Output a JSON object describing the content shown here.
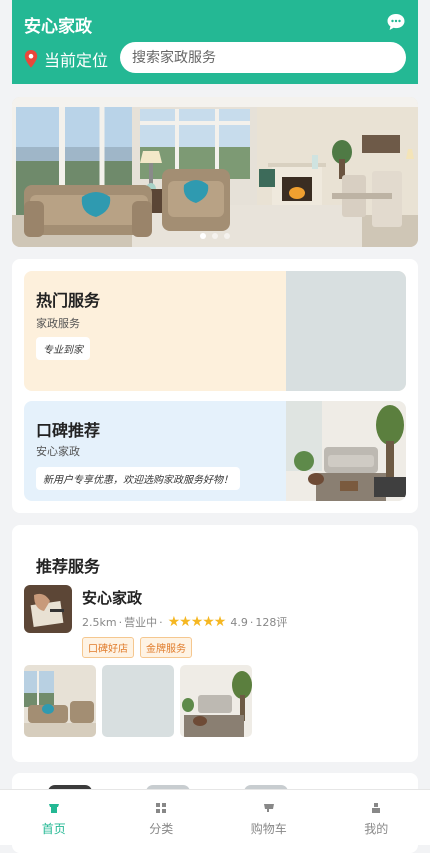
{
  "header": {
    "title": "安心家政",
    "location_label": "当前定位",
    "search_placeholder": "搜索家政服务",
    "chat_icon": "chat-bubble-icon",
    "location_icon": "location-pin-icon"
  },
  "banner": {
    "dots": 3,
    "active_dot": 0
  },
  "promos": [
    {
      "title": "热门服务",
      "subtitle": "家政服务",
      "tag": "专业到家"
    },
    {
      "title": "口碑推荐",
      "subtitle": "安心家政",
      "tag": "新用户专享优惠，欢迎选购家政服务好物！"
    }
  ],
  "recommend": {
    "section_title": "推荐服务",
    "shop": {
      "name": "安心家政",
      "distance": "2.5km",
      "status": "营业中",
      "rating": "4.9",
      "reviews": "128评",
      "stars": "★★★★★",
      "badges": [
        "口碑好店",
        "金牌服务"
      ]
    }
  },
  "nav": {
    "items": [
      {
        "label": "首页",
        "icon": "home-icon"
      },
      {
        "label": "分类",
        "icon": "grid-icon"
      },
      {
        "label": "购物车",
        "icon": "cart-icon"
      },
      {
        "label": "我的",
        "icon": "user-icon"
      }
    ],
    "active_index": 0
  },
  "colors": {
    "brand": "#24b894",
    "star": "#f5b722",
    "badge_text": "#e07b2a"
  }
}
